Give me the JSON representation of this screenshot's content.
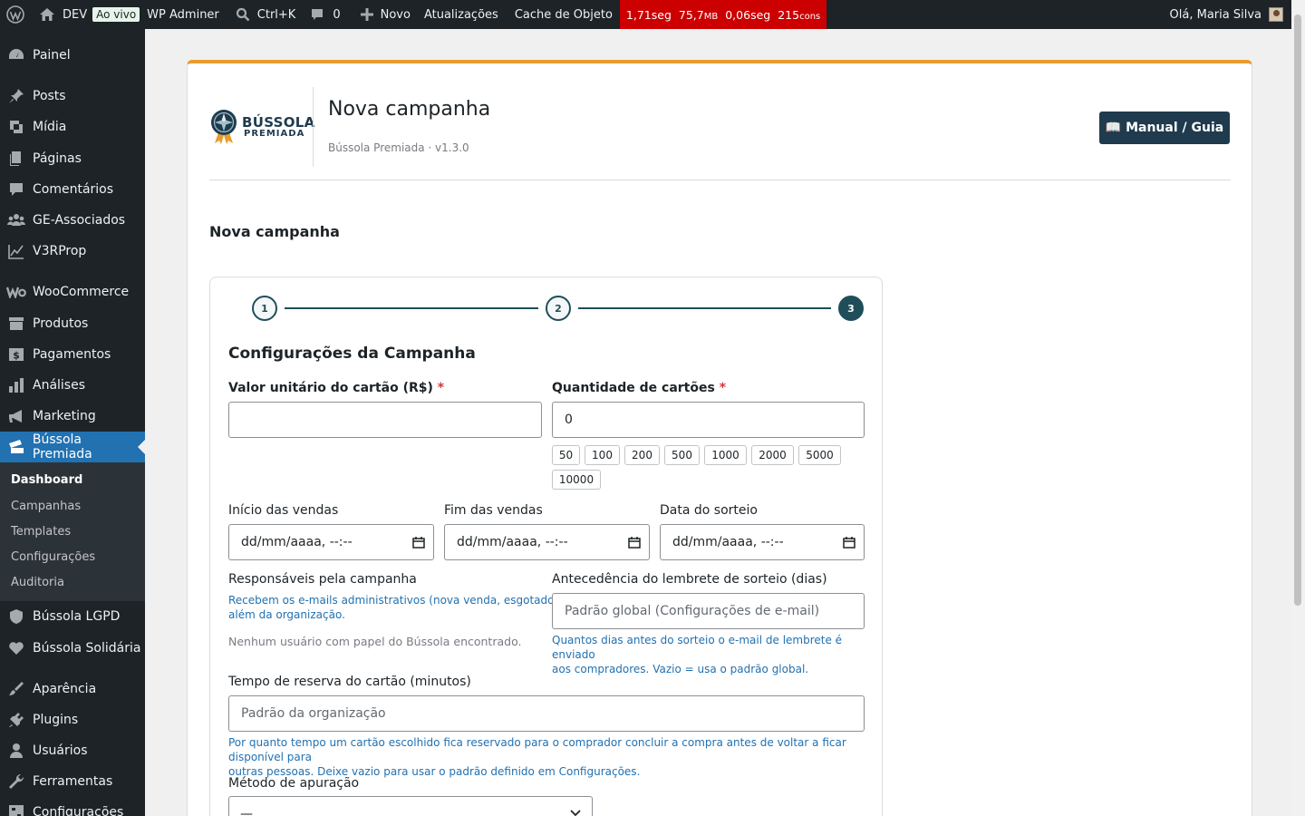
{
  "adminbar": {
    "site": "DEV",
    "live": "Ao vivo",
    "adminer": "WP Adminer",
    "search": "Ctrl+K",
    "comments": "0",
    "new": "Novo",
    "updates": "Atualizações",
    "cache": "Cache de Objeto",
    "qm": {
      "time": "1,71seg",
      "mem": "75,7",
      "mem_unit": "MB",
      "db": "0,06seg",
      "queries": "215",
      "queries_unit": "cons"
    },
    "greeting": "Olá, Maria Silva"
  },
  "sidebar": {
    "items": [
      {
        "label": "Painel",
        "icon": "dashboard-icon"
      },
      {
        "label": "Posts",
        "icon": "pin-icon"
      },
      {
        "label": "Mídia",
        "icon": "media-icon"
      },
      {
        "label": "Páginas",
        "icon": "pages-icon"
      },
      {
        "label": "Comentários",
        "icon": "comment-icon"
      },
      {
        "label": "GE-Associados",
        "icon": "groups-icon"
      },
      {
        "label": "V3RProp",
        "icon": "chart-line-icon"
      },
      {
        "label": "WooCommerce",
        "icon": "woo-icon"
      },
      {
        "label": "Produtos",
        "icon": "archive-icon"
      },
      {
        "label": "Pagamentos",
        "icon": "money-icon"
      },
      {
        "label": "Análises",
        "icon": "bar-chart-icon"
      },
      {
        "label": "Marketing",
        "icon": "megaphone-icon"
      },
      {
        "label": "Bússola Premiada",
        "icon": "tickets-icon"
      },
      {
        "label": "Bússola LGPD",
        "icon": "shield-icon"
      },
      {
        "label": "Bússola Solidária",
        "icon": "heart-icon"
      },
      {
        "label": "Aparência",
        "icon": "brush-icon"
      },
      {
        "label": "Plugins",
        "icon": "plugin-icon"
      },
      {
        "label": "Usuários",
        "icon": "user-icon"
      },
      {
        "label": "Ferramentas",
        "icon": "wrench-icon"
      },
      {
        "label": "Configurações",
        "icon": "settings-icon"
      }
    ],
    "submenu": [
      "Dashboard",
      "Campanhas",
      "Templates",
      "Configurações",
      "Auditoria"
    ]
  },
  "header": {
    "brand_title": "BÚSSOLA",
    "brand_sub": "PREMIADA",
    "title": "Nova campanha",
    "version": "Bússola Premiada · v1.3.0",
    "manual": "📖 Manual / Guia"
  },
  "section_title": "Nova campanha",
  "form": {
    "steps": [
      "1",
      "2",
      "3"
    ],
    "title": "Configurações da Campanha",
    "valor_label": "Valor unitário do cartão (R$)",
    "qtd_label": "Quantidade de cartões",
    "qtd_value": "0",
    "chips": [
      "50",
      "100",
      "200",
      "500",
      "1000",
      "2000",
      "5000",
      "10000"
    ],
    "inicio_label": "Início das vendas",
    "fim_label": "Fim das vendas",
    "sorteio_label": "Data do sorteio",
    "date_ph": "dd/mm/aaaa, --:--",
    "resp_label": "Responsáveis pela campanha",
    "resp_help_1": "Recebem os e-mails administrativos (nova venda, esgotado…)",
    "resp_help_2": "além da organização.",
    "resp_empty": "Nenhum usuário com papel do Bússola encontrado.",
    "lembrete_label": "Antecedência do lembrete de sorteio (dias)",
    "lembrete_ph": "Padrão global (Configurações de e-mail)",
    "lembrete_help_1": "Quantos dias antes do sorteio o e-mail de lembrete é enviado",
    "lembrete_help_2": "aos compradores. Vazio = usa o padrão global.",
    "reserva_label": "Tempo de reserva do cartão (minutos)",
    "reserva_ph": "Padrão da organização",
    "reserva_help_1": "Por quanto tempo um cartão escolhido fica reservado para o comprador concluir a compra antes de voltar a ficar disponível para",
    "reserva_help_2": "outras pessoas. Deixe vazio para usar o padrão definido em Configurações.",
    "metodo_label": "Método de apuração",
    "metodo_value": "—"
  }
}
